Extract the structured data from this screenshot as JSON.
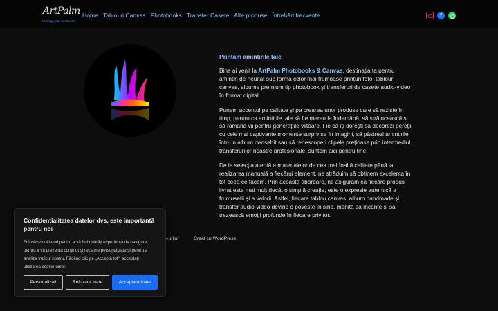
{
  "header": {
    "logo_script": "ArtPalm",
    "logo_tagline": "Printing your memories",
    "nav": [
      {
        "label": "Home"
      },
      {
        "label": "Tablouri Canvas"
      },
      {
        "label": "Photobooks"
      },
      {
        "label": "Transfer Casete"
      },
      {
        "label": "Alte produse"
      },
      {
        "label": "Întrebări frecvente"
      }
    ],
    "social": [
      "instagram-icon",
      "facebook-icon",
      "whatsapp-icon"
    ]
  },
  "main": {
    "tagline": "Printăm amintirile tale",
    "intro_before": "Bine ai venit la ",
    "brand": "ArtPalm Photobooks & Canvas",
    "intro_after": ", destinația ta pentru amintiri de neuitat sub forma celor mai frumoase printuri foto, tablouri canvas, albume premium tip photobook și transferuri de casete audio-video în format digital.",
    "para2": "Punem accentul pe calitate și pe crearea unor produse care să reziste în timp, pentru ca amintirile tale să fie mereu la îndemână, să strălucească și să rămână vii pentru generațiile viitoare. Fie că îți dorești să decorezi pereții cu cele mai captivante momente surprinse în imagini, să păstrezi amintirile într-un album deosebit sau să redescoperi clipele prețioase prin intermediul transferurilor noastre profesionale, suntem aici pentru tine.",
    "para3": "De la selecția atentă a materialelor de cea mai înaltă calitate până la realizarea manuală a fiecărui element, ne străduim să obținem excelența în tot ceea ce facem. Prin această abordare, ne asigurăm că fiecare produs livrat este mai mult decât o simplă creație; este o expresie autentică a frumuseții și a valorii. Astfel, fiecare tablou canvas, album handmade și transfer audio-video devine o poveste în sine, menită să încânte și să trezească emoții profunde în fiecare privitor."
  },
  "footer": {
    "link1": "ie-urilor",
    "link2": "Creat cu WordPress"
  },
  "cookie": {
    "title": "Confidențialitatea datelor dvs. este importantă pentru noi",
    "text": "Folosim cookie-uri pentru a vă îmbunătăți experiența de navigare, pentru a vă prezenta conținut și reclame personalizate și pentru a analiza traficul nostru. Făcând clic pe „Acceptă tot”, acceptați utilizarea cookie-urilor.",
    "btn_customize": "Personalizați",
    "btn_reject": "Refuzare toate",
    "btn_accept": "Acceptare toate"
  },
  "colors": {
    "accent": "#8fc3ff",
    "accept_button": "#1a6cf0"
  }
}
